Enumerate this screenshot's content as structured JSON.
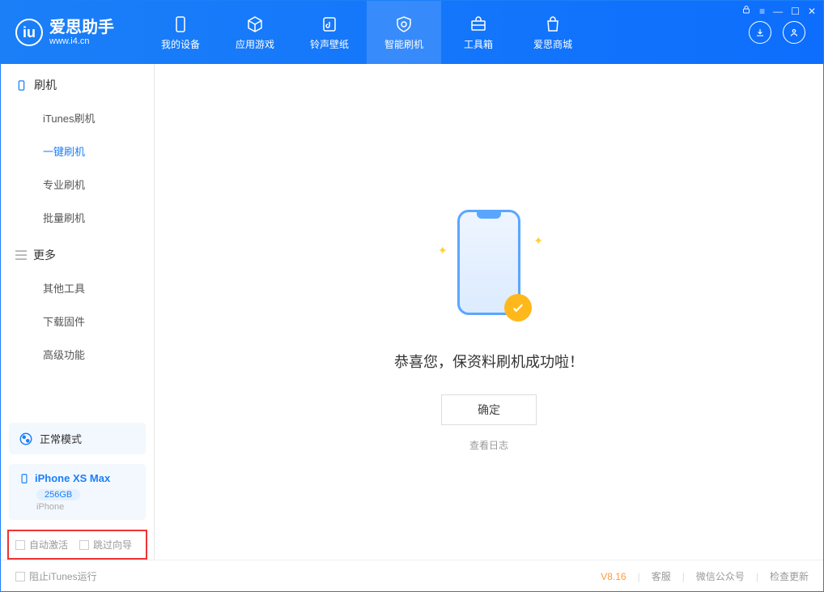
{
  "logo": {
    "title": "爱思助手",
    "subtitle": "www.i4.cn"
  },
  "nav": {
    "items": [
      {
        "label": "我的设备"
      },
      {
        "label": "应用游戏"
      },
      {
        "label": "铃声壁纸"
      },
      {
        "label": "智能刷机"
      },
      {
        "label": "工具箱"
      },
      {
        "label": "爱思商城"
      }
    ]
  },
  "sidebar": {
    "section1_title": "刷机",
    "section1_items": [
      "iTunes刷机",
      "一键刷机",
      "专业刷机",
      "批量刷机"
    ],
    "section2_title": "更多",
    "section2_items": [
      "其他工具",
      "下载固件",
      "高级功能"
    ]
  },
  "mode_box": "正常模式",
  "device": {
    "name": "iPhone XS Max",
    "capacity": "256GB",
    "type": "iPhone"
  },
  "checks": {
    "auto_activate": "自动激活",
    "skip_guide": "跳过向导"
  },
  "main": {
    "success_text": "恭喜您，保资料刷机成功啦！",
    "ok_button": "确定",
    "view_log": "查看日志"
  },
  "footer": {
    "block_itunes": "阻止iTunes运行",
    "version": "V8.16",
    "support": "客服",
    "wechat": "微信公众号",
    "check_update": "检查更新"
  }
}
